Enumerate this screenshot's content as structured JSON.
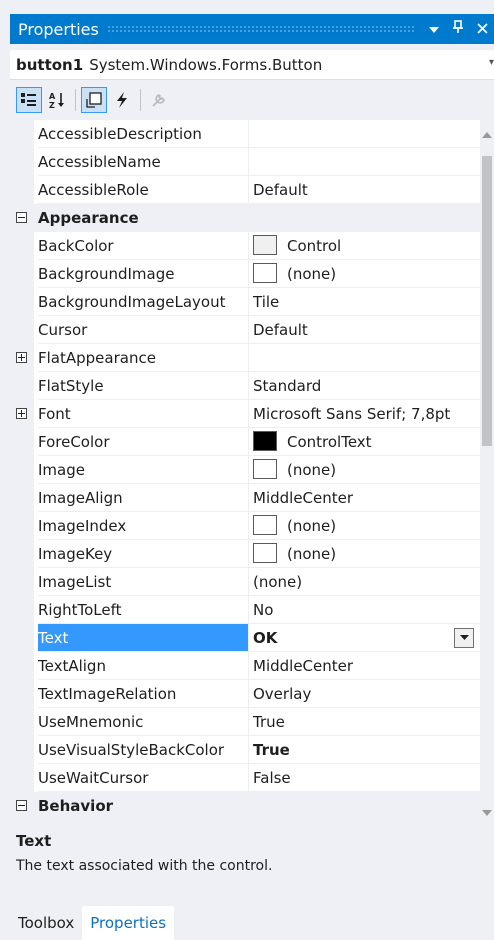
{
  "panel": {
    "title": "Properties",
    "buttons": {
      "dropdown": "▼",
      "pin": "ᵖ",
      "close": "✕"
    }
  },
  "object": {
    "name": "button1",
    "type": "System.Windows.Forms.Button"
  },
  "toolbar": {
    "icons": [
      "categorized-icon",
      "alphabetical-icon",
      "properties-icon",
      "events-icon",
      "property-pages-icon"
    ]
  },
  "rows": [
    {
      "name": "AccessibleDescription",
      "value": ""
    },
    {
      "name": "AccessibleName",
      "value": ""
    },
    {
      "name": "AccessibleRole",
      "value": "Default"
    },
    {
      "category": "Appearance"
    },
    {
      "name": "BackColor",
      "value": "Control",
      "swatch": "#f0f0f0"
    },
    {
      "name": "BackgroundImage",
      "value": "(none)",
      "swatch": "#ffffff"
    },
    {
      "name": "BackgroundImageLayout",
      "value": "Tile"
    },
    {
      "name": "Cursor",
      "value": "Default"
    },
    {
      "name": "FlatAppearance",
      "value": "",
      "expandable": true
    },
    {
      "name": "FlatStyle",
      "value": "Standard"
    },
    {
      "name": "Font",
      "value": "Microsoft Sans Serif; 7,8pt",
      "expandable": true
    },
    {
      "name": "ForeColor",
      "value": "ControlText",
      "swatch": "#000000"
    },
    {
      "name": "Image",
      "value": "(none)",
      "swatch": "#ffffff"
    },
    {
      "name": "ImageAlign",
      "value": "MiddleCenter"
    },
    {
      "name": "ImageIndex",
      "value": "(none)",
      "swatch": "#ffffff"
    },
    {
      "name": "ImageKey",
      "value": "(none)",
      "swatch": "#ffffff"
    },
    {
      "name": "ImageList",
      "value": "(none)"
    },
    {
      "name": "RightToLeft",
      "value": "No"
    },
    {
      "name": "Text",
      "value": "OK",
      "bold": true,
      "selected": true,
      "dropdown": true
    },
    {
      "name": "TextAlign",
      "value": "MiddleCenter"
    },
    {
      "name": "TextImageRelation",
      "value": "Overlay"
    },
    {
      "name": "UseMnemonic",
      "value": "True"
    },
    {
      "name": "UseVisualStyleBackColor",
      "value": "True",
      "bold": true
    },
    {
      "name": "UseWaitCursor",
      "value": "False"
    },
    {
      "category": "Behavior"
    }
  ],
  "description": {
    "title": "Text",
    "text": "The text associated with the control."
  },
  "tabs": [
    {
      "label": "Toolbox",
      "active": false
    },
    {
      "label": "Properties",
      "active": true
    }
  ],
  "colors": {
    "accent": "#007acc",
    "selection": "#3399ff",
    "panel_bg": "#eef0f5"
  }
}
